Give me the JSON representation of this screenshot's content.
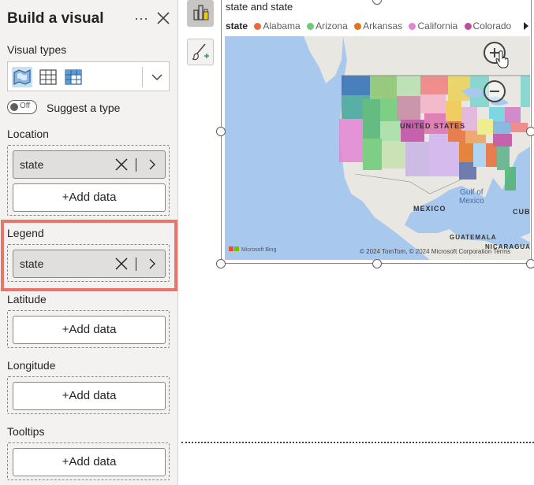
{
  "pane": {
    "title": "Build a visual",
    "more_label": "···",
    "visual_types_label": "Visual types",
    "visual_types": [
      {
        "icon": "map-visual-icon",
        "selected": true
      },
      {
        "icon": "table-visual-icon",
        "selected": false
      },
      {
        "icon": "matrix-visual-icon",
        "selected": false
      }
    ],
    "suggest_toggle": {
      "state_label": "Off",
      "label": "Suggest a type"
    },
    "wells": [
      {
        "label": "Location",
        "field": "state",
        "add_label": "+Add data"
      },
      {
        "label": "Legend",
        "field": "state"
      },
      {
        "label": "Latitude",
        "add_label": "+Add data"
      },
      {
        "label": "Longitude",
        "add_label": "+Add data"
      },
      {
        "label": "Tooltips",
        "add_label": "+Add data"
      }
    ]
  },
  "visual": {
    "title": "state and state",
    "legend": {
      "title": "state",
      "items": [
        {
          "label": "Alabama",
          "color": "#e66c37"
        },
        {
          "label": "Arizona",
          "color": "#6bcb77"
        },
        {
          "label": "Arkansas",
          "color": "#e3741e"
        },
        {
          "label": "California",
          "color": "#e385d4"
        },
        {
          "label": "Colorado",
          "color": "#c14ba3"
        }
      ]
    },
    "map": {
      "country_label_us": "UNITED STATES",
      "country_label_mx": "MEXICO",
      "country_label_cuba": "CUBA",
      "country_label_gt": "GUATEMALA",
      "country_label_ni": "NICARAGUA",
      "gulf_label": "Gulf of\nMexico",
      "copyright": "© 2024 TomTom, © 2024 Microsoft Corporation  Terms",
      "provider": "Microsoft Bing",
      "water_color": "#a8c8ed",
      "land_color": "#e9e7e2"
    }
  }
}
